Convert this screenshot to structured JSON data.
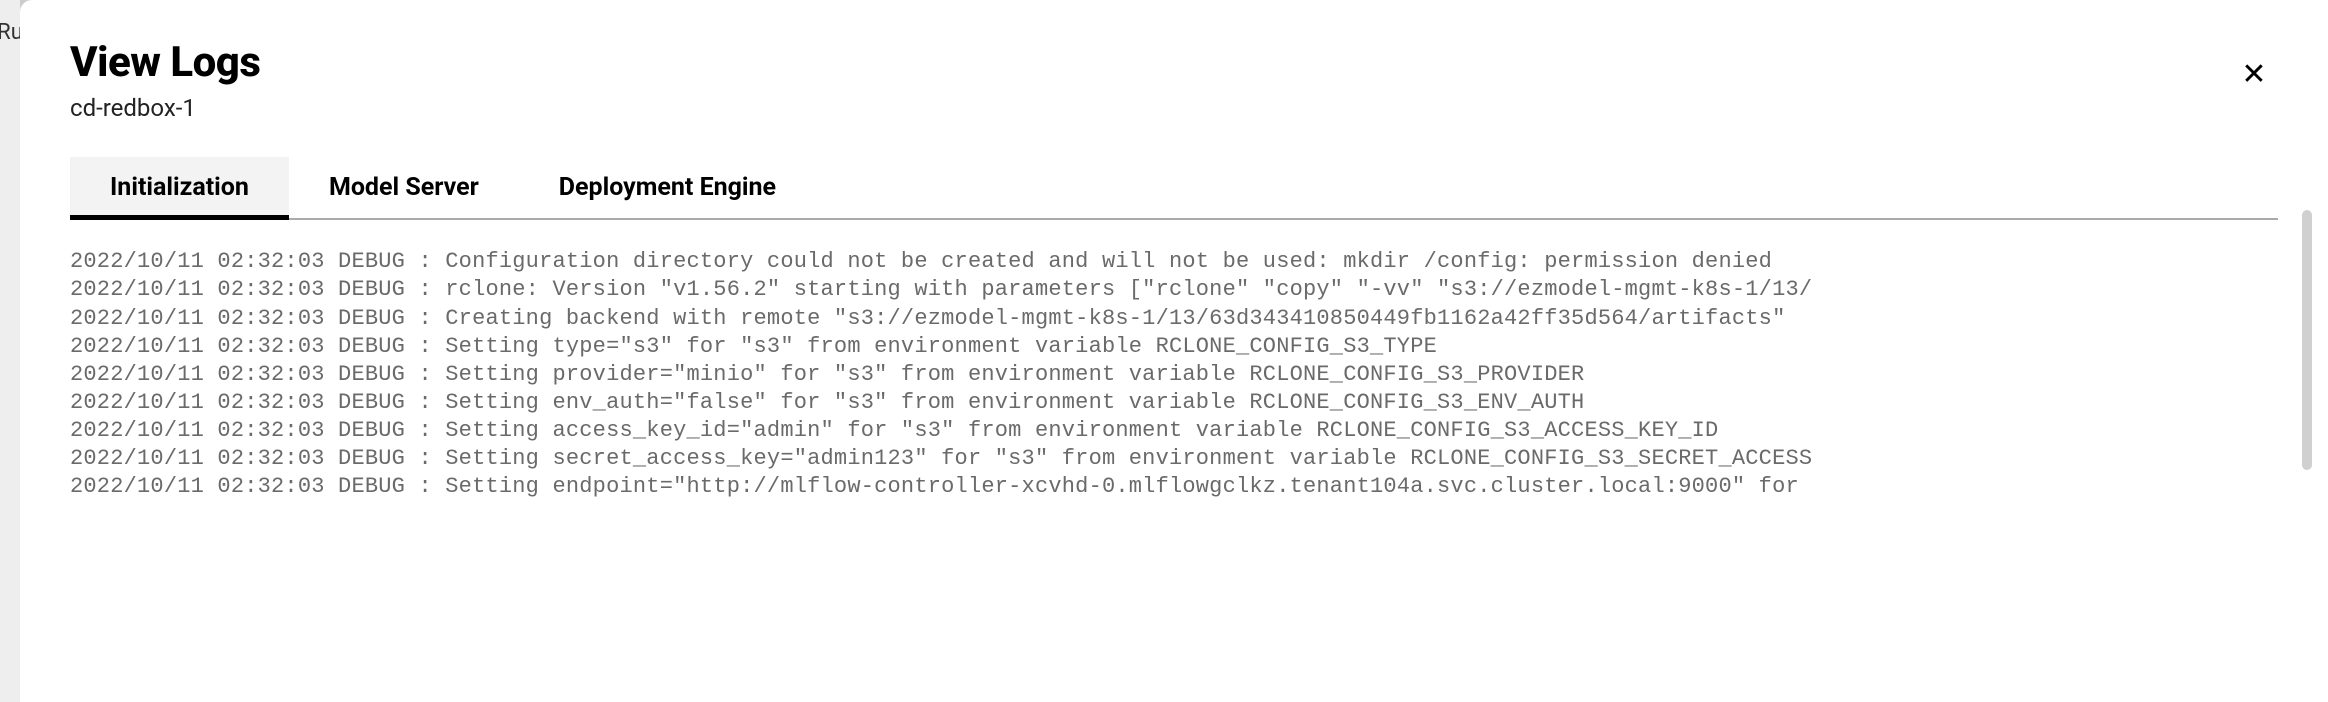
{
  "backdrop": {
    "partial_text": "Ru"
  },
  "modal": {
    "title": "View Logs",
    "subtitle": "cd-redbox-1",
    "close_icon": "✕"
  },
  "tabs": [
    {
      "label": "Initialization",
      "active": true
    },
    {
      "label": "Model Server",
      "active": false
    },
    {
      "label": "Deployment Engine",
      "active": false
    }
  ],
  "logs": [
    "2022/10/11 02:32:03 DEBUG : Configuration directory could not be created and will not be used: mkdir /config: permission denied",
    "2022/10/11 02:32:03 DEBUG : rclone: Version \"v1.56.2\" starting with parameters [\"rclone\" \"copy\" \"-vv\" \"s3://ezmodel-mgmt-k8s-1/13/",
    "2022/10/11 02:32:03 DEBUG : Creating backend with remote \"s3://ezmodel-mgmt-k8s-1/13/63d343410850449fb1162a42ff35d564/artifacts\"",
    "2022/10/11 02:32:03 DEBUG : Setting type=\"s3\" for \"s3\" from environment variable RCLONE_CONFIG_S3_TYPE",
    "2022/10/11 02:32:03 DEBUG : Setting provider=\"minio\" for \"s3\" from environment variable RCLONE_CONFIG_S3_PROVIDER",
    "2022/10/11 02:32:03 DEBUG : Setting env_auth=\"false\" for \"s3\" from environment variable RCLONE_CONFIG_S3_ENV_AUTH",
    "2022/10/11 02:32:03 DEBUG : Setting access_key_id=\"admin\" for \"s3\" from environment variable RCLONE_CONFIG_S3_ACCESS_KEY_ID",
    "2022/10/11 02:32:03 DEBUG : Setting secret_access_key=\"admin123\" for \"s3\" from environment variable RCLONE_CONFIG_S3_SECRET_ACCESS",
    "2022/10/11 02:32:03 DEBUG : Setting endpoint=\"http://mlflow-controller-xcvhd-0.mlflowgclkz.tenant104a.svc.cluster.local:9000\" for"
  ]
}
